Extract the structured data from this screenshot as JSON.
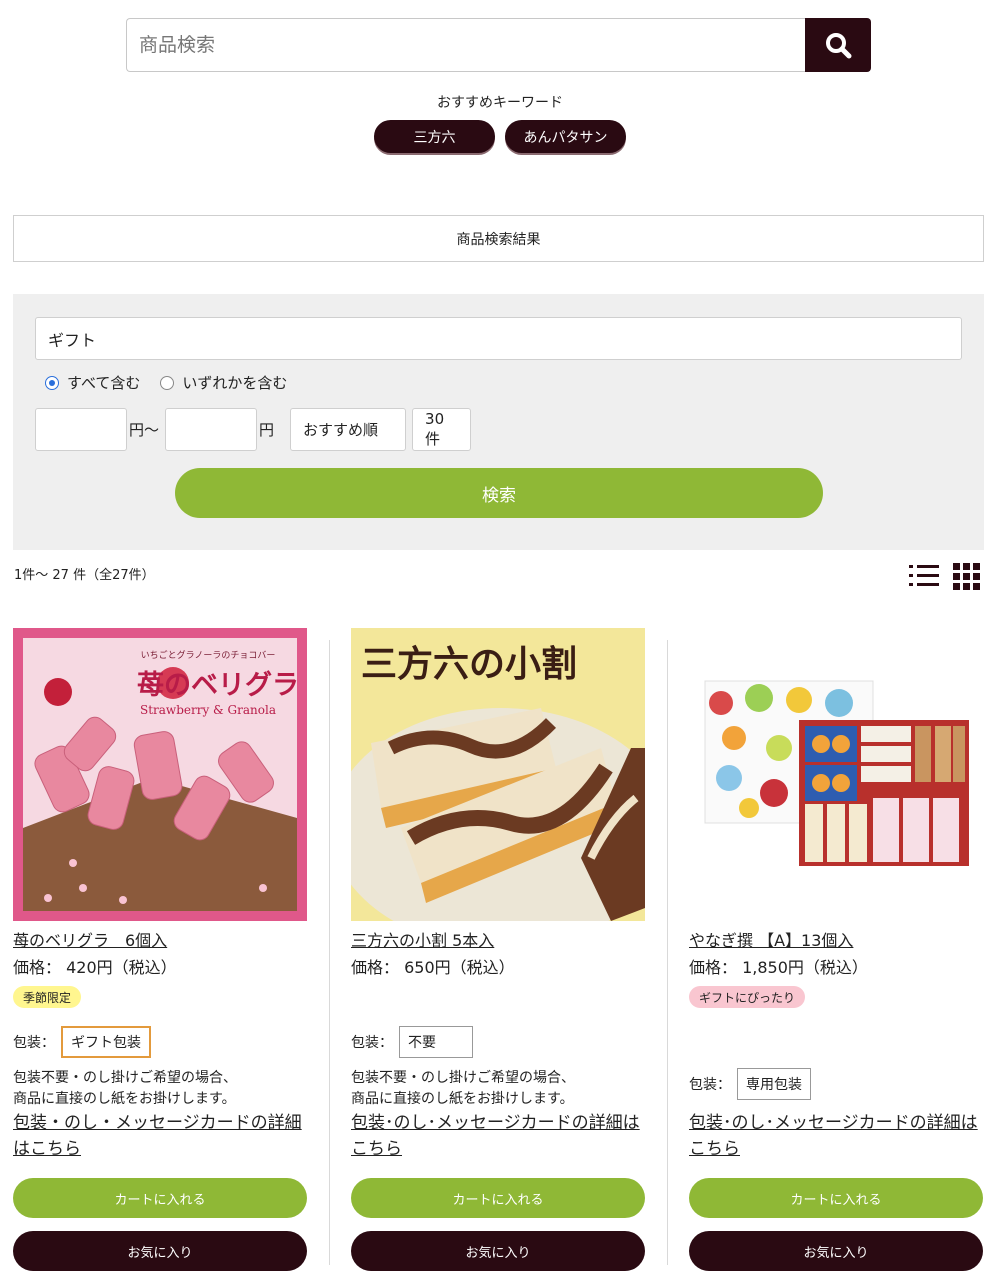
{
  "search": {
    "placeholder": "商品検索",
    "button_icon": "search-icon"
  },
  "keywords": {
    "title": "おすすめキーワード",
    "items": [
      "三方六",
      "あんパタサン"
    ]
  },
  "results_header": "商品検索結果",
  "filter": {
    "keyword_value": "ギフト",
    "radio_all": "すべて含む",
    "radio_any": "いずれかを含む",
    "price_from_value": "",
    "price_unit_from": "円〜",
    "price_to_value": "",
    "price_unit_to": "円",
    "sort_selected": "おすすめ順",
    "per_page_selected": "30件",
    "search_button": "検索"
  },
  "count_text": "1件〜 27 件（全27件）",
  "products": [
    {
      "image_title": "苺のベリグラ",
      "image_subtitle": "Strawberry & Granola",
      "image_tagline": "いちごとグラノーラのチョコバー",
      "name": "苺のベリグラ　6個入",
      "price": "価格：  420円（税込）",
      "badge": "季節限定",
      "pack_label": "包装：",
      "pack_value": "ギフト包装",
      "note_line1": "包装不要・のし掛けご希望の場合、",
      "note_line2": "商品に直接のし紙をお掛けします。",
      "detail_link": "包装・のし・メッセージカードの詳細はこちら",
      "cart_button": "カートに入れる",
      "fav_button": "お気に入り"
    },
    {
      "image_title": "三方六の小割",
      "name": "三方六の小割 5本入",
      "price": "価格：  650円（税込）",
      "badge": "",
      "pack_label": "包装：",
      "pack_value": "不要",
      "note_line1": "包装不要・のし掛けご希望の場合、",
      "note_line2": "商品に直接のし紙をお掛けします。",
      "detail_link": "包装･のし･メッセージカードの詳細はこちら",
      "cart_button": "カートに入れる",
      "fav_button": "お気に入り"
    },
    {
      "name": "やなぎ撰 【A】13個入",
      "price": "価格：  1,850円（税込）",
      "badge": "ギフトにぴったり",
      "pack_label": "包装：",
      "pack_value": "専用包装",
      "detail_link": "包装･のし･メッセージカードの詳細はこちら",
      "cart_button": "カートに入れる",
      "fav_button": "お気に入り"
    }
  ],
  "colors": {
    "brand_dark": "#2a0a12",
    "accent_green": "#8fb836",
    "badge_yellow": "#fff68f",
    "badge_pink": "#f9c6d0"
  }
}
